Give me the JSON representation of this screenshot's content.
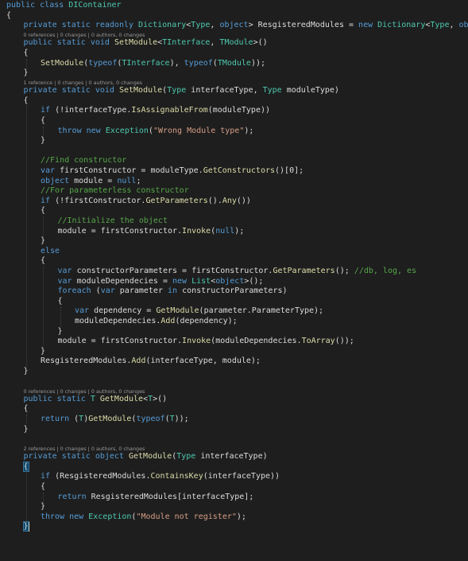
{
  "editor": {
    "language": "C#",
    "theme": {
      "background": "#1e1e1e",
      "plain": "#dcdcdc",
      "keyword": "#569cd6",
      "type": "#4ec9b0",
      "method": "#dcdcaa",
      "string": "#d69d85",
      "comment": "#57a64a",
      "codelens": "#999999",
      "brace_highlight": "#0e4a6e"
    },
    "lines": [
      {
        "kind": "code",
        "indent": 0,
        "tokens": [
          [
            "keyword",
            "public"
          ],
          [
            "plain",
            " "
          ],
          [
            "keyword",
            "class"
          ],
          [
            "plain",
            " "
          ],
          [
            "type",
            "DIContainer"
          ]
        ]
      },
      {
        "kind": "code",
        "indent": 0,
        "tokens": [
          [
            "plain",
            "{"
          ]
        ]
      },
      {
        "kind": "code",
        "indent": 1,
        "tokens": [
          [
            "keyword",
            "private"
          ],
          [
            "plain",
            " "
          ],
          [
            "keyword",
            "static"
          ],
          [
            "plain",
            " "
          ],
          [
            "keyword",
            "readonly"
          ],
          [
            "plain",
            " "
          ],
          [
            "type",
            "Dictionary"
          ],
          [
            "plain",
            "<"
          ],
          [
            "type",
            "Type"
          ],
          [
            "plain",
            ", "
          ],
          [
            "keyword",
            "object"
          ],
          [
            "plain",
            "> ResgisteredModules = "
          ],
          [
            "keyword",
            "new"
          ],
          [
            "plain",
            " "
          ],
          [
            "type",
            "Dictionary"
          ],
          [
            "plain",
            "<"
          ],
          [
            "type",
            "Type"
          ],
          [
            "plain",
            ", "
          ],
          [
            "keyword",
            "object"
          ],
          [
            "plain",
            ">();"
          ]
        ]
      },
      {
        "kind": "lens",
        "indent": 1,
        "parts": [
          "0 references",
          "0 changes",
          "0 authors, 0 changes"
        ]
      },
      {
        "kind": "code",
        "indent": 1,
        "tokens": [
          [
            "keyword",
            "public"
          ],
          [
            "plain",
            " "
          ],
          [
            "keyword",
            "static"
          ],
          [
            "plain",
            " "
          ],
          [
            "keyword",
            "void"
          ],
          [
            "plain",
            " "
          ],
          [
            "method",
            "SetModule"
          ],
          [
            "plain",
            "<"
          ],
          [
            "type",
            "TInterface"
          ],
          [
            "plain",
            ", "
          ],
          [
            "type",
            "TModule"
          ],
          [
            "plain",
            ">()"
          ]
        ]
      },
      {
        "kind": "code",
        "indent": 1,
        "tokens": [
          [
            "plain",
            "{"
          ]
        ]
      },
      {
        "kind": "code",
        "indent": 2,
        "tokens": [
          [
            "method",
            "SetModule"
          ],
          [
            "plain",
            "("
          ],
          [
            "keyword",
            "typeof"
          ],
          [
            "plain",
            "("
          ],
          [
            "type",
            "TInterface"
          ],
          [
            "plain",
            "), "
          ],
          [
            "keyword",
            "typeof"
          ],
          [
            "plain",
            "("
          ],
          [
            "type",
            "TModule"
          ],
          [
            "plain",
            "));"
          ]
        ]
      },
      {
        "kind": "code",
        "indent": 1,
        "tokens": [
          [
            "plain",
            "}"
          ]
        ]
      },
      {
        "kind": "lens",
        "indent": 1,
        "parts": [
          "1 reference",
          "0 changes",
          "0 authors, 0 changes"
        ]
      },
      {
        "kind": "code",
        "indent": 1,
        "tokens": [
          [
            "keyword",
            "private"
          ],
          [
            "plain",
            " "
          ],
          [
            "keyword",
            "static"
          ],
          [
            "plain",
            " "
          ],
          [
            "keyword",
            "void"
          ],
          [
            "plain",
            " "
          ],
          [
            "method",
            "SetModule"
          ],
          [
            "plain",
            "("
          ],
          [
            "type",
            "Type"
          ],
          [
            "plain",
            " interfaceType, "
          ],
          [
            "type",
            "Type"
          ],
          [
            "plain",
            " moduleType)"
          ]
        ]
      },
      {
        "kind": "code",
        "indent": 1,
        "tokens": [
          [
            "plain",
            "{"
          ]
        ]
      },
      {
        "kind": "code",
        "indent": 2,
        "tokens": [
          [
            "keyword",
            "if"
          ],
          [
            "plain",
            " (!interfaceType."
          ],
          [
            "method",
            "IsAssignableFrom"
          ],
          [
            "plain",
            "(moduleType))"
          ]
        ]
      },
      {
        "kind": "code",
        "indent": 2,
        "tokens": [
          [
            "plain",
            "{"
          ]
        ]
      },
      {
        "kind": "code",
        "indent": 3,
        "tokens": [
          [
            "keyword",
            "throw"
          ],
          [
            "plain",
            " "
          ],
          [
            "keyword",
            "new"
          ],
          [
            "plain",
            " "
          ],
          [
            "type",
            "Exception"
          ],
          [
            "plain",
            "("
          ],
          [
            "string",
            "\"Wrong Module type\""
          ],
          [
            "plain",
            ");"
          ]
        ]
      },
      {
        "kind": "code",
        "indent": 2,
        "tokens": [
          [
            "plain",
            "}"
          ]
        ]
      },
      {
        "kind": "code",
        "indent": 0,
        "tokens": []
      },
      {
        "kind": "code",
        "indent": 2,
        "tokens": [
          [
            "comment",
            "//Find constructor"
          ]
        ]
      },
      {
        "kind": "code",
        "indent": 2,
        "tokens": [
          [
            "keyword",
            "var"
          ],
          [
            "plain",
            " firstConstructor = moduleType."
          ],
          [
            "method",
            "GetConstructors"
          ],
          [
            "plain",
            "()[0];"
          ]
        ]
      },
      {
        "kind": "code",
        "indent": 2,
        "tokens": [
          [
            "keyword",
            "object"
          ],
          [
            "plain",
            " module = "
          ],
          [
            "keyword",
            "null"
          ],
          [
            "plain",
            ";"
          ]
        ]
      },
      {
        "kind": "code",
        "indent": 2,
        "tokens": [
          [
            "comment",
            "//For parameterless constructor"
          ]
        ]
      },
      {
        "kind": "code",
        "indent": 2,
        "tokens": [
          [
            "keyword",
            "if"
          ],
          [
            "plain",
            " (!firstConstructor."
          ],
          [
            "method",
            "GetParameters"
          ],
          [
            "plain",
            "()."
          ],
          [
            "method",
            "Any"
          ],
          [
            "plain",
            "())"
          ]
        ]
      },
      {
        "kind": "code",
        "indent": 2,
        "tokens": [
          [
            "plain",
            "{"
          ]
        ]
      },
      {
        "kind": "code",
        "indent": 3,
        "tokens": [
          [
            "comment",
            "//Initialize the object"
          ]
        ]
      },
      {
        "kind": "code",
        "indent": 3,
        "tokens": [
          [
            "plain",
            "module = firstConstructor."
          ],
          [
            "method",
            "Invoke"
          ],
          [
            "plain",
            "("
          ],
          [
            "keyword",
            "null"
          ],
          [
            "plain",
            ");"
          ]
        ]
      },
      {
        "kind": "code",
        "indent": 2,
        "tokens": [
          [
            "plain",
            "}"
          ]
        ]
      },
      {
        "kind": "code",
        "indent": 2,
        "tokens": [
          [
            "keyword",
            "else"
          ]
        ]
      },
      {
        "kind": "code",
        "indent": 2,
        "tokens": [
          [
            "plain",
            "{"
          ]
        ]
      },
      {
        "kind": "code",
        "indent": 3,
        "tokens": [
          [
            "keyword",
            "var"
          ],
          [
            "plain",
            " constructorParameters = firstConstructor."
          ],
          [
            "method",
            "GetParameters"
          ],
          [
            "plain",
            "(); "
          ],
          [
            "comment",
            "//db, log, es"
          ]
        ]
      },
      {
        "kind": "code",
        "indent": 3,
        "tokens": [
          [
            "keyword",
            "var"
          ],
          [
            "plain",
            " moduleDependecies = "
          ],
          [
            "keyword",
            "new"
          ],
          [
            "plain",
            " "
          ],
          [
            "type",
            "List"
          ],
          [
            "plain",
            "<"
          ],
          [
            "keyword",
            "object"
          ],
          [
            "plain",
            ">();"
          ]
        ]
      },
      {
        "kind": "code",
        "indent": 3,
        "tokens": [
          [
            "keyword",
            "foreach"
          ],
          [
            "plain",
            " ("
          ],
          [
            "keyword",
            "var"
          ],
          [
            "plain",
            " parameter "
          ],
          [
            "keyword",
            "in"
          ],
          [
            "plain",
            " constructorParameters)"
          ]
        ]
      },
      {
        "kind": "code",
        "indent": 3,
        "tokens": [
          [
            "plain",
            "{"
          ]
        ]
      },
      {
        "kind": "code",
        "indent": 4,
        "tokens": [
          [
            "keyword",
            "var"
          ],
          [
            "plain",
            " dependency = "
          ],
          [
            "method",
            "GetModule"
          ],
          [
            "plain",
            "(parameter.ParameterType);"
          ]
        ]
      },
      {
        "kind": "code",
        "indent": 4,
        "tokens": [
          [
            "plain",
            "moduleDependecies."
          ],
          [
            "method",
            "Add"
          ],
          [
            "plain",
            "(dependency);"
          ]
        ]
      },
      {
        "kind": "code",
        "indent": 3,
        "tokens": [
          [
            "plain",
            "}"
          ]
        ]
      },
      {
        "kind": "code",
        "indent": 3,
        "tokens": [
          [
            "plain",
            "module = firstConstructor."
          ],
          [
            "method",
            "Invoke"
          ],
          [
            "plain",
            "(moduleDependecies."
          ],
          [
            "method",
            "ToArray"
          ],
          [
            "plain",
            "());"
          ]
        ]
      },
      {
        "kind": "code",
        "indent": 2,
        "tokens": [
          [
            "plain",
            "}"
          ]
        ]
      },
      {
        "kind": "code",
        "indent": 2,
        "tokens": [
          [
            "plain",
            "ResgisteredModules."
          ],
          [
            "method",
            "Add"
          ],
          [
            "plain",
            "(interfaceType, module);"
          ]
        ]
      },
      {
        "kind": "code",
        "indent": 1,
        "tokens": [
          [
            "plain",
            "}"
          ]
        ]
      },
      {
        "kind": "code",
        "indent": 0,
        "tokens": []
      },
      {
        "kind": "lens",
        "indent": 1,
        "parts": [
          "0 references",
          "0 changes",
          "0 authors, 0 changes"
        ]
      },
      {
        "kind": "code",
        "indent": 1,
        "tokens": [
          [
            "keyword",
            "public"
          ],
          [
            "plain",
            " "
          ],
          [
            "keyword",
            "static"
          ],
          [
            "plain",
            " "
          ],
          [
            "type",
            "T"
          ],
          [
            "plain",
            " "
          ],
          [
            "method",
            "GetModule"
          ],
          [
            "plain",
            "<"
          ],
          [
            "type",
            "T"
          ],
          [
            "plain",
            ">()"
          ]
        ]
      },
      {
        "kind": "code",
        "indent": 1,
        "tokens": [
          [
            "plain",
            "{"
          ]
        ]
      },
      {
        "kind": "code",
        "indent": 2,
        "tokens": [
          [
            "keyword",
            "return"
          ],
          [
            "plain",
            " ("
          ],
          [
            "type",
            "T"
          ],
          [
            "plain",
            ")"
          ],
          [
            "method",
            "GetModule"
          ],
          [
            "plain",
            "("
          ],
          [
            "keyword",
            "typeof"
          ],
          [
            "plain",
            "("
          ],
          [
            "type",
            "T"
          ],
          [
            "plain",
            "));"
          ]
        ]
      },
      {
        "kind": "code",
        "indent": 1,
        "tokens": [
          [
            "plain",
            "}"
          ]
        ]
      },
      {
        "kind": "code",
        "indent": 0,
        "tokens": []
      },
      {
        "kind": "lens",
        "indent": 1,
        "parts": [
          "2 references",
          "0 changes",
          "0 authors, 0 changes"
        ]
      },
      {
        "kind": "code",
        "indent": 1,
        "tokens": [
          [
            "keyword",
            "private"
          ],
          [
            "plain",
            " "
          ],
          [
            "keyword",
            "static"
          ],
          [
            "plain",
            " "
          ],
          [
            "keyword",
            "object"
          ],
          [
            "plain",
            " "
          ],
          [
            "method",
            "GetModule"
          ],
          [
            "plain",
            "("
          ],
          [
            "type",
            "Type"
          ],
          [
            "plain",
            " interfaceType)"
          ]
        ]
      },
      {
        "kind": "code",
        "indent": 1,
        "tokens": [
          [
            "plain",
            "{"
          ]
        ],
        "highlight_brace": true
      },
      {
        "kind": "code",
        "indent": 2,
        "tokens": [
          [
            "keyword",
            "if"
          ],
          [
            "plain",
            " (ResgisteredModules."
          ],
          [
            "method",
            "ContainsKey"
          ],
          [
            "plain",
            "(interfaceType))"
          ]
        ]
      },
      {
        "kind": "code",
        "indent": 2,
        "tokens": [
          [
            "plain",
            "{"
          ]
        ]
      },
      {
        "kind": "code",
        "indent": 3,
        "tokens": [
          [
            "keyword",
            "return"
          ],
          [
            "plain",
            " ResgisteredModules[interfaceType];"
          ]
        ]
      },
      {
        "kind": "code",
        "indent": 2,
        "tokens": [
          [
            "plain",
            "}"
          ]
        ]
      },
      {
        "kind": "code",
        "indent": 2,
        "tokens": [
          [
            "keyword",
            "throw"
          ],
          [
            "plain",
            " "
          ],
          [
            "keyword",
            "new"
          ],
          [
            "plain",
            " "
          ],
          [
            "type",
            "Exception"
          ],
          [
            "plain",
            "("
          ],
          [
            "string",
            "\"Module not register\""
          ],
          [
            "plain",
            ");"
          ]
        ]
      },
      {
        "kind": "code",
        "indent": 1,
        "tokens": [
          [
            "plain",
            "}"
          ]
        ],
        "highlight_brace": true,
        "caret": true
      }
    ]
  }
}
